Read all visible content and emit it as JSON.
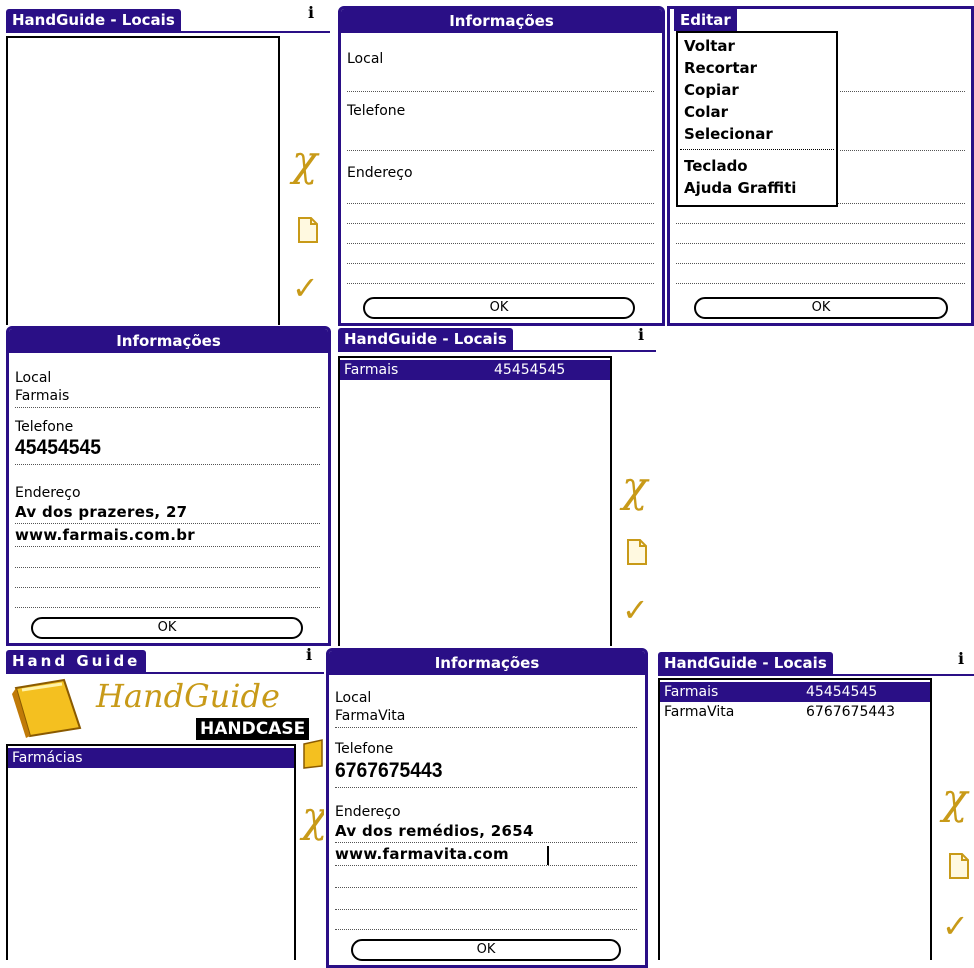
{
  "colors": {
    "title_bar": "#2a0f86",
    "accent_icon": "#c89a18"
  },
  "icons": {
    "info": "info-icon",
    "delete": "delete-x-icon",
    "new": "new-document-icon",
    "done": "checkmark-icon",
    "book": "book-icon"
  },
  "app": {
    "title_locais": "HandGuide - Locais",
    "title_home": "Hand Guide",
    "info_glyph": "i"
  },
  "dialog": {
    "title": "Informações",
    "label_local": "Local",
    "label_telefone": "Telefone",
    "label_endereco": "Endereço",
    "ok": "OK"
  },
  "icons_glyphs": {
    "x": "χ",
    "check": "✓"
  },
  "menu": {
    "title": "Editar",
    "items": [
      "Voltar",
      "Recortar",
      "Copiar",
      "Colar",
      "Selecionar"
    ],
    "items2": [
      "Teclado",
      "Ajuda Graffiti"
    ]
  },
  "record1": {
    "local": "Farmais",
    "telefone": "45454545",
    "endereco1": "Av dos prazeres, 27",
    "endereco2": "www.farmais.com.br"
  },
  "record2": {
    "local": "FarmaVita",
    "telefone": "6767675443",
    "endereco1": "Av dos remédios, 2654",
    "endereco2": "www.farmavita.com"
  },
  "list1": [
    {
      "name": "Farmais",
      "phone": "45454545"
    }
  ],
  "list2": [
    {
      "name": "Farmais",
      "phone": "45454545"
    },
    {
      "name": "FarmaVita",
      "phone": "6767675443"
    }
  ],
  "home": {
    "logo_text": "HandGuide",
    "brand": "HANDCASE",
    "category": "Farmácias"
  }
}
